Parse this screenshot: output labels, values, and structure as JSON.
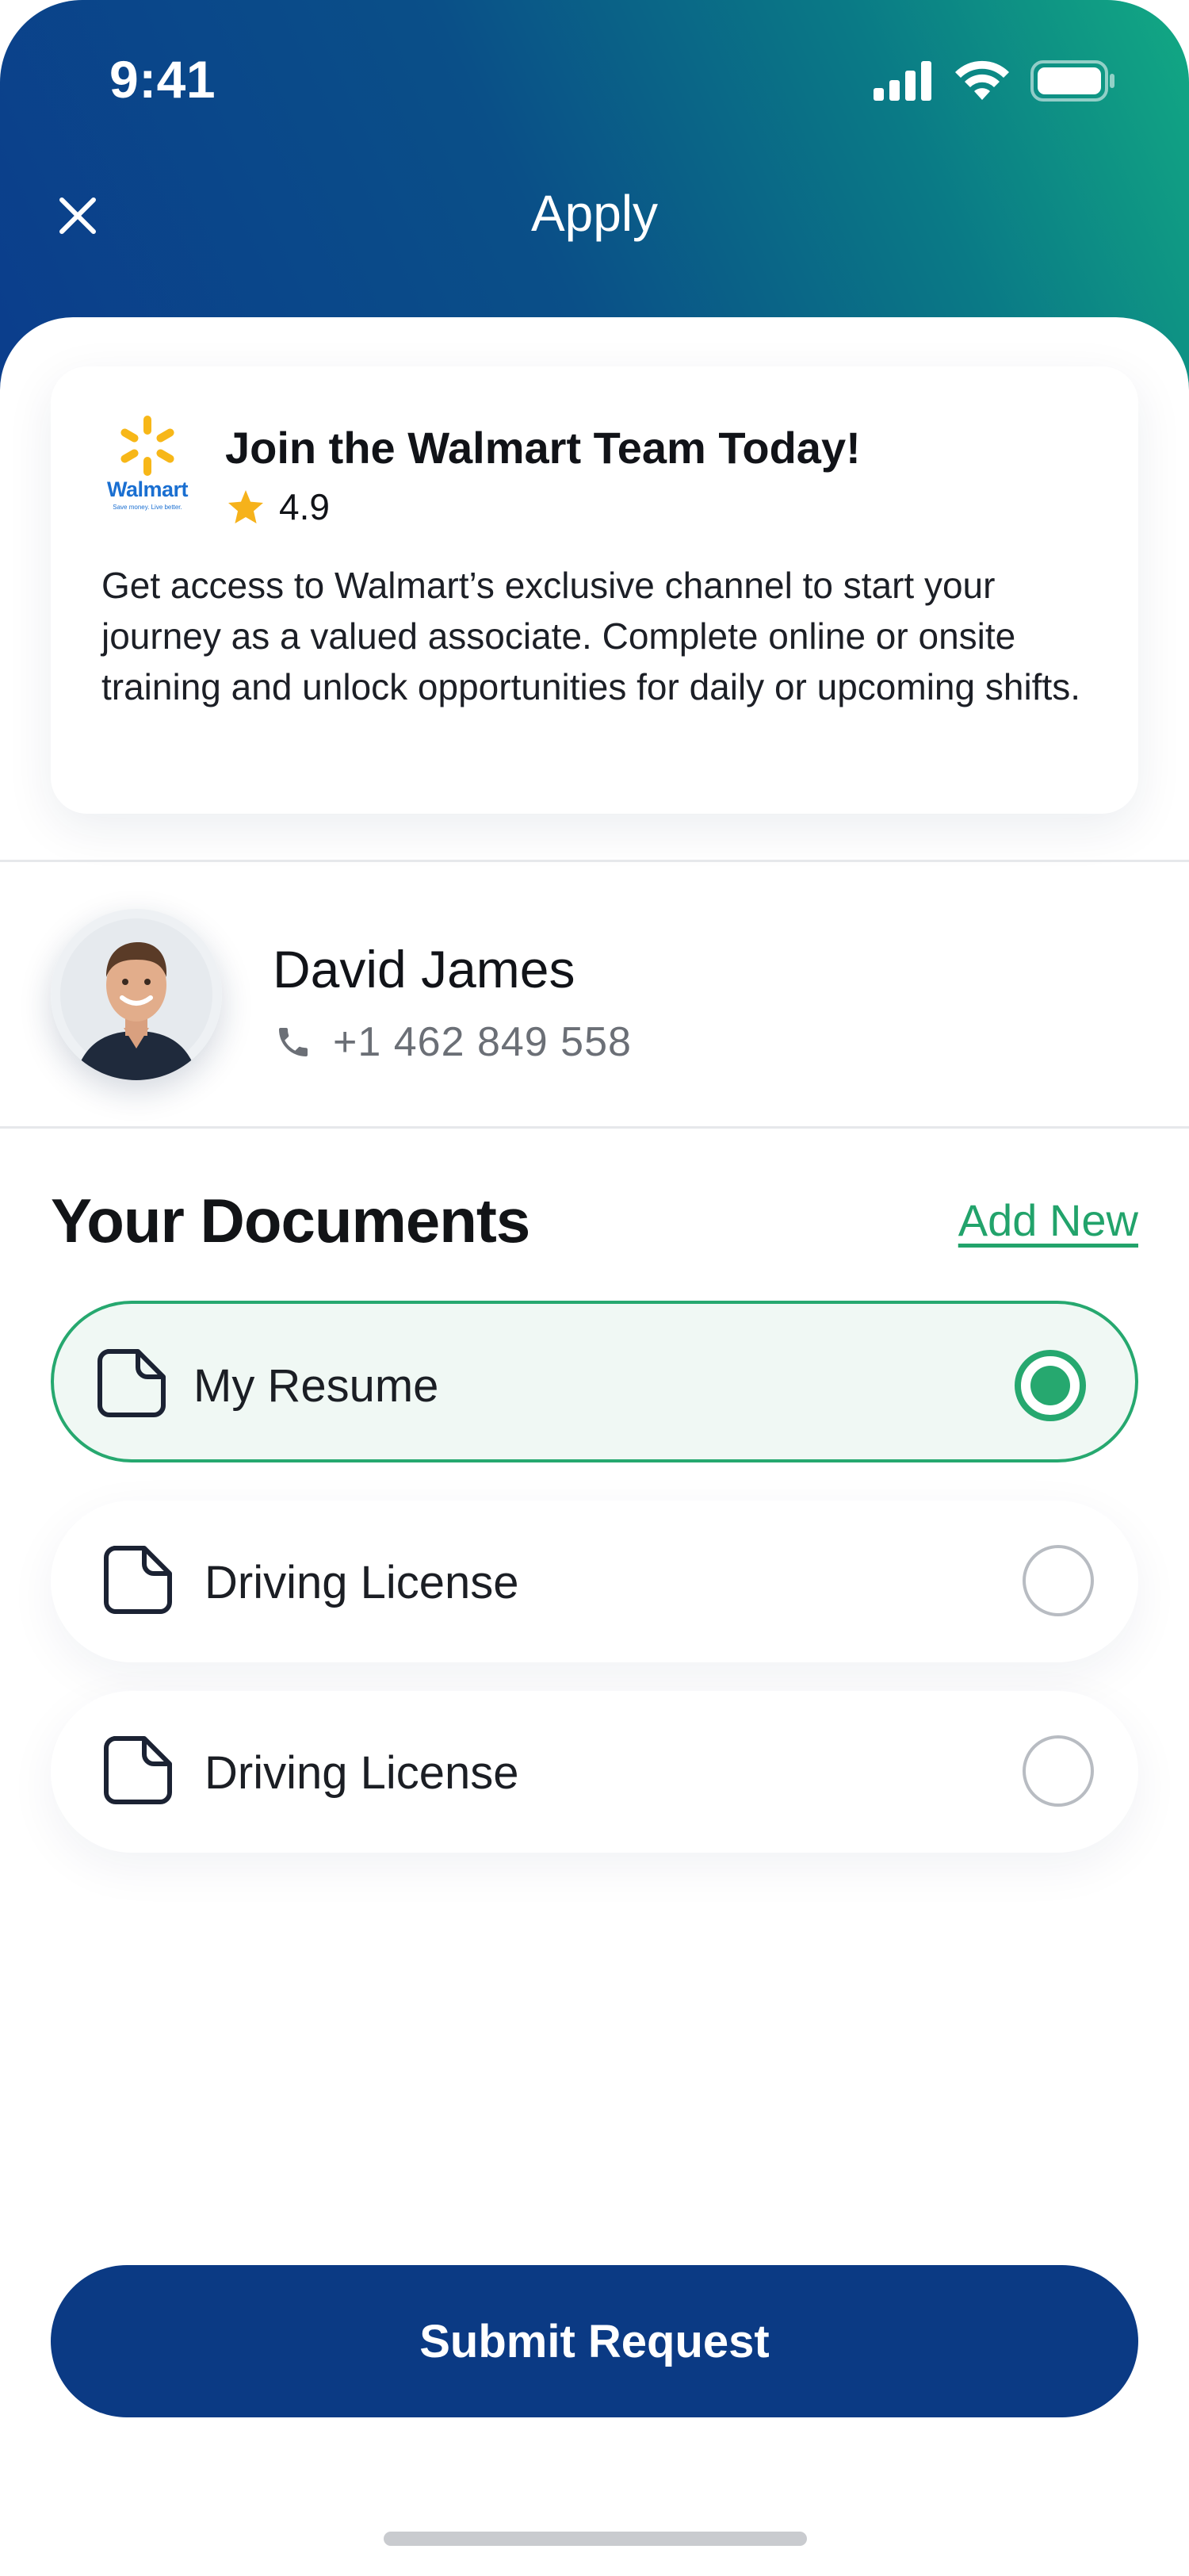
{
  "status_bar": {
    "time": "9:41"
  },
  "header": {
    "title": "Apply"
  },
  "job_card": {
    "logo_text": "Walmart",
    "logo_tagline": "Save money. Live better.",
    "title": "Join the Walmart Team Today!",
    "rating": "4.9",
    "description": "Get access to Walmart’s exclusive channel to start your journey as a valued associate. Complete online or onsite training and unlock opportunities for daily or upcoming shifts."
  },
  "profile": {
    "name": "David James",
    "phone": "+1 462 849 558"
  },
  "documents": {
    "title": "Your Documents",
    "add_new_label": "Add New",
    "items": [
      {
        "label": "My Resume",
        "selected": true
      },
      {
        "label": "Driving License",
        "selected": false
      },
      {
        "label": "Driving License",
        "selected": false
      }
    ]
  },
  "submit_label": "Submit Request",
  "colors": {
    "brand_blue": "#0b3a84",
    "accent_green": "#26a86f",
    "star": "#f6b21b"
  }
}
